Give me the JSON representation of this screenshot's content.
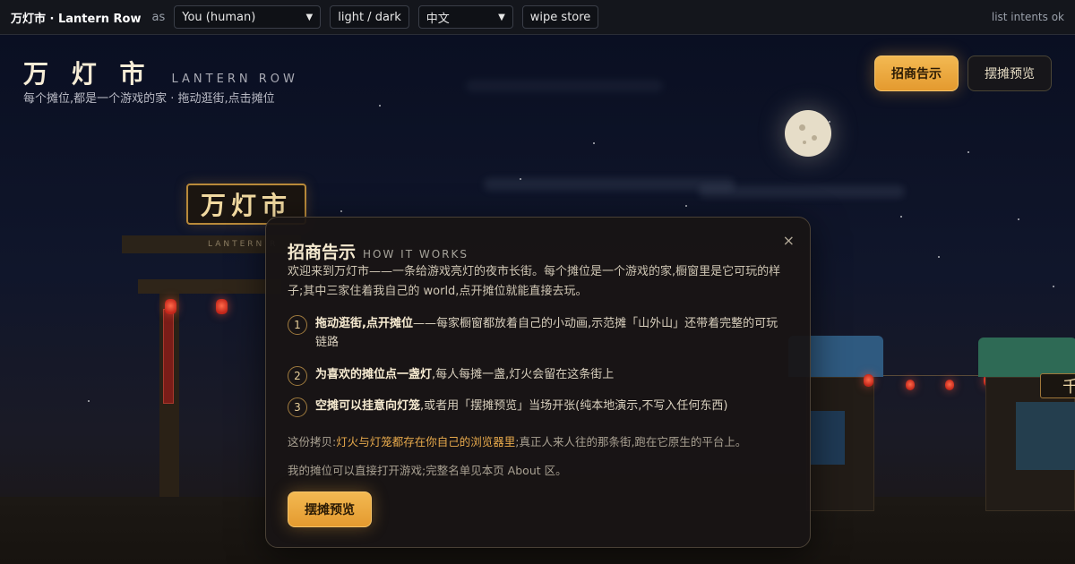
{
  "toolbar": {
    "brand": "万灯市 · Lantern Row",
    "as_label": "as",
    "role_value": "You (human)",
    "theme_button": "light / dark",
    "lang_value": "中文",
    "wipe_button": "wipe store",
    "status": "list intents ok"
  },
  "header": {
    "title_zh": "万 灯 市",
    "title_en": "LANTERN ROW",
    "subtitle": "每个摊位,都是一个游戏的家 · 拖动逛街,点击摊位",
    "btn_notice": "招商告示",
    "btn_preview": "摆摊预览"
  },
  "scene": {
    "gate_sign": "万灯市",
    "gate_label": "LANTERN R",
    "stall_sign": "千"
  },
  "modal": {
    "close": "×",
    "title_zh": "招商告示",
    "title_en": "HOW IT WORKS",
    "intro": "欢迎来到万灯市——一条给游戏亮灯的夜市长街。每个摊位是一个游戏的家,橱窗里是它可玩的样子;其中三家住着我自己的 world,点开摊位就能直接去玩。",
    "steps": [
      {
        "num": "1",
        "bold": "拖动逛街,点开摊位",
        "text": "——每家橱窗都放着自己的小动画,示范摊「山外山」还带着完整的可玩链路"
      },
      {
        "num": "2",
        "bold": "为喜欢的摊位点一盏灯",
        "text": ",每人每摊一盏,灯火会留在这条街上"
      },
      {
        "num": "3",
        "bold": "空摊可以挂意向灯笼",
        "text": ",或者用「摆摊预览」当场开张(纯本地演示,不写入任何东西)"
      }
    ],
    "note1_pre": "这份拷贝:",
    "note1_hl": "灯火与灯笼都存在你自己的浏览器里",
    "note1_post": ";真正人来人往的那条街,跑在它原生的平台上。",
    "note2": "我的摊位可以直接打开游戏;完整名单见本页 About 区。",
    "button": "摆摊预览"
  },
  "colors": {
    "accent_gold": "#e9a63c",
    "night_sky": "#0c1020",
    "lantern_red": "#c2261a"
  }
}
